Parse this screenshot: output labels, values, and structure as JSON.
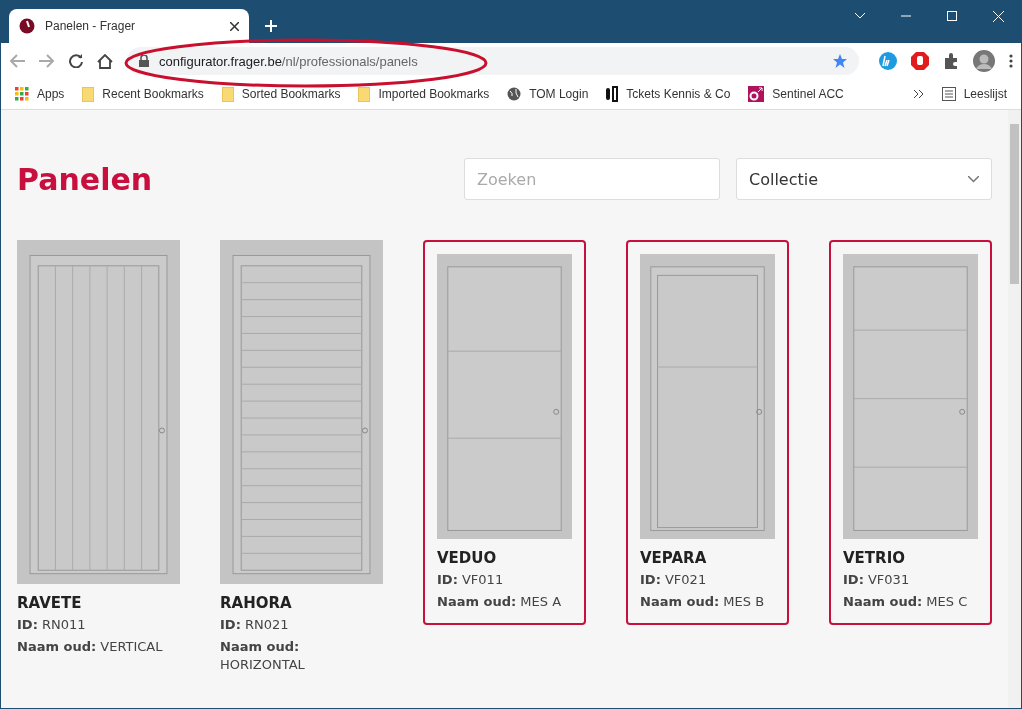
{
  "browser": {
    "tab_title": "Panelen - Frager",
    "url_host": "configurator.frager.be",
    "url_path": "/nl/professionals/panels",
    "bookmarks": [
      {
        "label": "Apps",
        "kind": "apps"
      },
      {
        "label": "Recent Bookmarks",
        "kind": "folder"
      },
      {
        "label": "Sorted Bookmarks",
        "kind": "folder"
      },
      {
        "label": "Imported Bookmarks",
        "kind": "folder"
      },
      {
        "label": "TOM Login",
        "kind": "globe"
      },
      {
        "label": "Tckets Kennis & Co",
        "kind": "tickets"
      },
      {
        "label": "Sentinel ACC",
        "kind": "sentinel"
      }
    ],
    "reading_list": "Leeslijst"
  },
  "page": {
    "title": "Panelen",
    "search": {
      "placeholder": "Zoeken"
    },
    "collection": {
      "value": "Collectie"
    },
    "panels": [
      {
        "name": "RAVETE",
        "id_label": "ID:",
        "id": "RN011",
        "old_label": "Naam oud:",
        "old": "VERTICAL",
        "highlighted": false,
        "kind": "vertical"
      },
      {
        "name": "RAHORA",
        "id_label": "ID:",
        "id": "RN021",
        "old_label": "Naam oud:",
        "old": "HORIZONTAL",
        "highlighted": false,
        "kind": "horizontal"
      },
      {
        "name": "VEDUO",
        "id_label": "ID:",
        "id": "VF011",
        "old_label": "Naam oud:",
        "old": "MES A",
        "highlighted": true,
        "kind": "duo"
      },
      {
        "name": "VEPARA",
        "id_label": "ID:",
        "id": "VF021",
        "old_label": "Naam oud:",
        "old": "MES B",
        "highlighted": true,
        "kind": "para"
      },
      {
        "name": "VETRIO",
        "id_label": "ID:",
        "id": "VF031",
        "old_label": "Naam oud:",
        "old": "MES C",
        "highlighted": true,
        "kind": "trio"
      }
    ]
  }
}
